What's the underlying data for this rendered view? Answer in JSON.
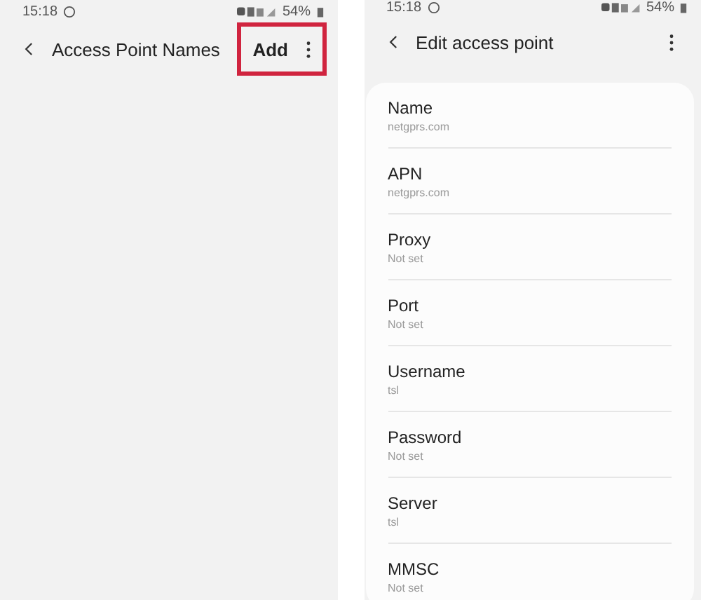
{
  "screens": [
    {
      "status_bar": {
        "time": "15:18",
        "battery": "54%"
      },
      "header": {
        "title": "Access Point Names",
        "action": "Add",
        "highlighted": true
      }
    },
    {
      "status_bar": {
        "time": "15:18",
        "battery": "54%"
      },
      "header": {
        "title": "Edit access point"
      },
      "fields": [
        {
          "label": "Name",
          "value": "netgprs.com"
        },
        {
          "label": "APN",
          "value": "netgprs.com"
        },
        {
          "label": "Proxy",
          "value": "Not set"
        },
        {
          "label": "Port",
          "value": "Not set"
        },
        {
          "label": "Username",
          "value": "tsl"
        },
        {
          "label": "Password",
          "value": "Not set"
        },
        {
          "label": "Server",
          "value": "tsl"
        },
        {
          "label": "MMSC",
          "value": "Not set"
        }
      ]
    }
  ]
}
